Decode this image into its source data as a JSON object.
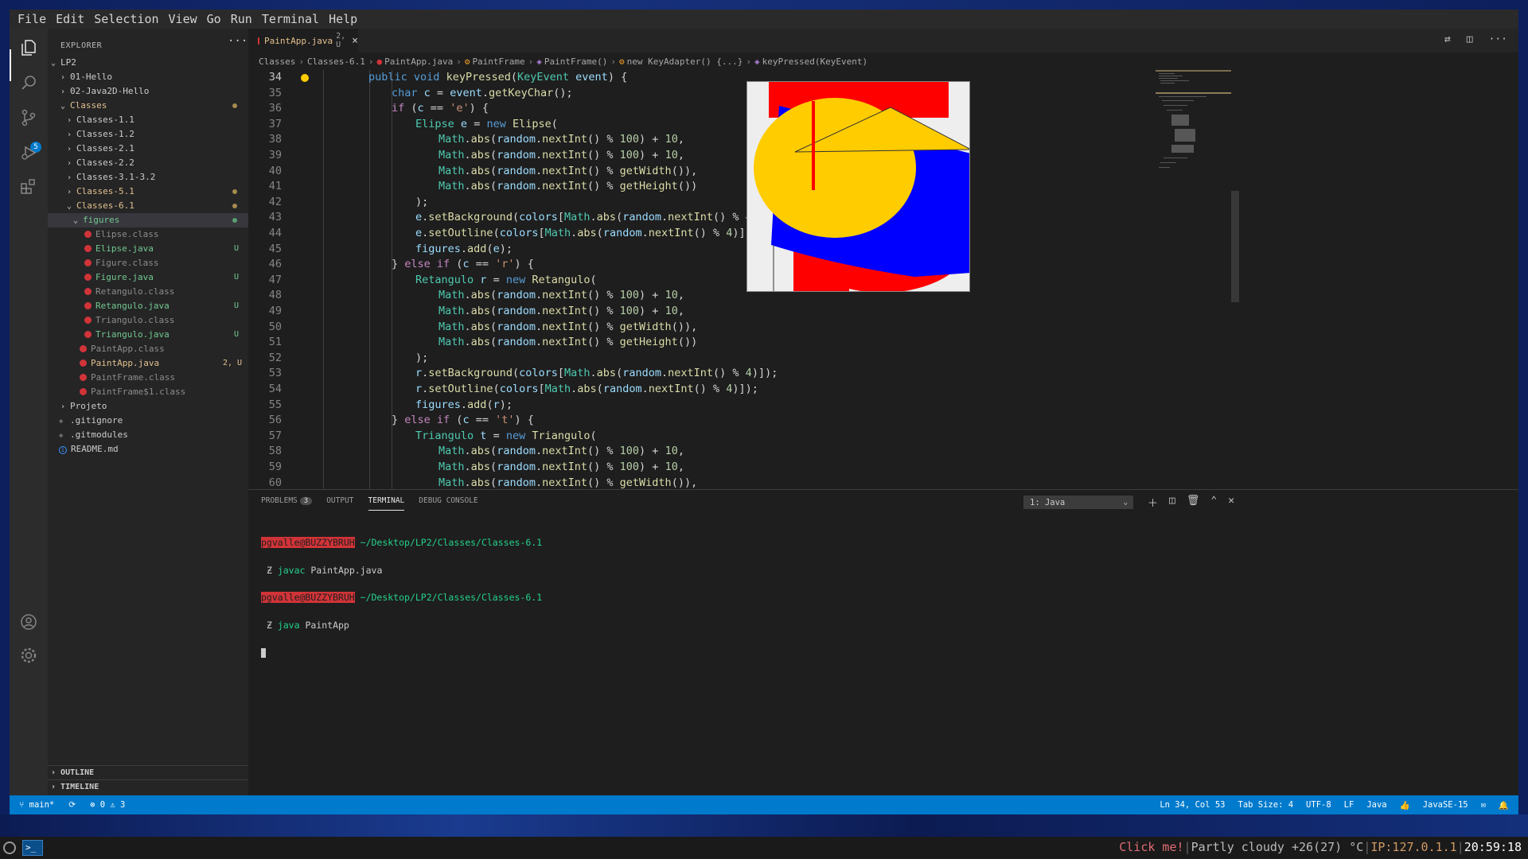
{
  "menu": [
    "File",
    "Edit",
    "Selection",
    "View",
    "Go",
    "Run",
    "Terminal",
    "Help"
  ],
  "activity": {
    "scm_badge": "5"
  },
  "explorer": {
    "title": "EXPLORER",
    "more": "···",
    "root": "LP2",
    "items": [
      {
        "label": "01-Hello"
      },
      {
        "label": "02-Java2D-Hello"
      },
      {
        "label": "Classes"
      },
      {
        "label": "Classes-1.1"
      },
      {
        "label": "Classes-1.2"
      },
      {
        "label": "Classes-2.1"
      },
      {
        "label": "Classes-2.2"
      },
      {
        "label": "Classes-3.1-3.2"
      },
      {
        "label": "Classes-5.1"
      },
      {
        "label": "Classes-6.1"
      },
      {
        "label": "figures"
      },
      {
        "label": "Elipse.class"
      },
      {
        "label": "Elipse.java",
        "deco": "U"
      },
      {
        "label": "Figure.class"
      },
      {
        "label": "Figure.java",
        "deco": "U"
      },
      {
        "label": "Retangulo.class"
      },
      {
        "label": "Retangulo.java",
        "deco": "U"
      },
      {
        "label": "Triangulo.class"
      },
      {
        "label": "Triangulo.java",
        "deco": "U"
      },
      {
        "label": "PaintApp.class"
      },
      {
        "label": "PaintApp.java",
        "deco": "2, U"
      },
      {
        "label": "PaintFrame.class"
      },
      {
        "label": "PaintFrame$1.class"
      },
      {
        "label": "Projeto"
      },
      {
        "label": ".gitignore"
      },
      {
        "label": ".gitmodules"
      },
      {
        "label": "README.md"
      }
    ],
    "sections": [
      "OUTLINE",
      "TIMELINE"
    ]
  },
  "tab": {
    "label": "PaintApp.java",
    "mod": "2, U",
    "close": "×"
  },
  "breadcrumbs": [
    "Classes",
    "Classes-6.1",
    "PaintApp.java",
    "PaintFrame",
    "PaintFrame()",
    "new KeyAdapter() {...}",
    "keyPressed(KeyEvent)"
  ],
  "code": {
    "line_numbers": [
      "34",
      "35",
      "36",
      "37",
      "38",
      "39",
      "40",
      "41",
      "42",
      "43",
      "44",
      "45",
      "46",
      "47",
      "48",
      "49",
      "50",
      "51",
      "52",
      "53",
      "54",
      "55",
      "56",
      "57",
      "58",
      "59",
      "60"
    ]
  },
  "panel": {
    "tabs": [
      "PROBLEMS",
      "OUTPUT",
      "TERMINAL",
      "DEBUG CONSOLE"
    ],
    "problems_count": "3",
    "terminal_select": "1: Java",
    "terminal": {
      "user": "pgvalle@BUZZYBRUH",
      "path": "~/Desktop/LP2/Classes/Classes-6.1",
      "prompt": "Ƶ",
      "cmd1": "javac",
      "arg1": "PaintApp.java",
      "cmd2": "java",
      "arg2": "PaintApp"
    }
  },
  "status": {
    "branch": "main*",
    "errors": "0",
    "warnings": "3",
    "position": "Ln 34, Col 53",
    "tab_size": "Tab Size: 4",
    "encoding": "UTF-8",
    "eol": "LF",
    "language": "Java",
    "jdk": "JavaSE-15"
  },
  "taskbar": {
    "click": "Click me!",
    "weather": "Partly cloudy +26(27) °C",
    "ip": "IP:127.0.1.1",
    "time": "20:59:18"
  },
  "colors": {
    "accent": "#007acc",
    "modified": "#e2c08d",
    "untracked": "#73c991",
    "error": "#d13438"
  }
}
